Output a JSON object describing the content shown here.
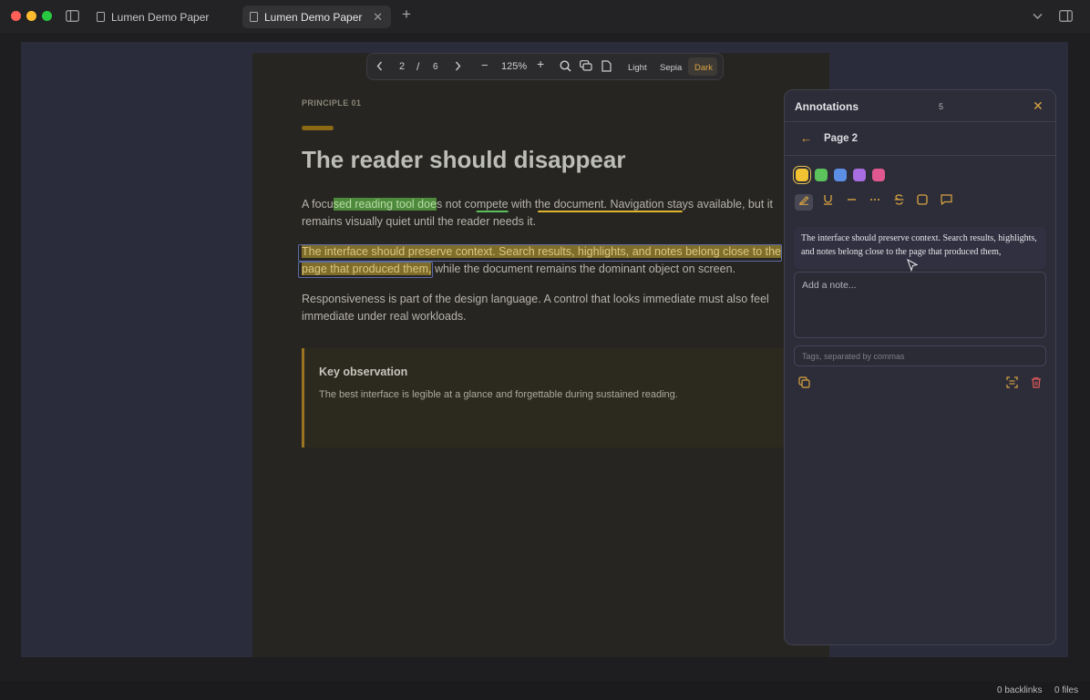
{
  "window": {
    "tabs": [
      {
        "label": "Lumen Demo Paper",
        "active": false
      },
      {
        "label": "Lumen Demo Paper",
        "active": true
      }
    ],
    "icons": [
      "sidebar-toggle-icon",
      "new-tab-icon",
      "chevron-down-icon",
      "right-panel-icon"
    ]
  },
  "toolbar": {
    "current_page": "2",
    "separator": "/",
    "total_pages": "6",
    "zoom": "125%",
    "themes": [
      "Light",
      "Sepia",
      "Dark"
    ],
    "active_theme": "Dark"
  },
  "document": {
    "eyebrow": "PRINCIPLE 01",
    "title": "The reader should disappear",
    "p1": {
      "a": "A focu",
      "hl_green": "sed reading tool doe",
      "b": "s not ",
      "c": "co",
      "ul_green": "mpete",
      "d": " with ",
      "e": "t",
      "ul_yellow": "he document. Navigation sta",
      "f": "ys available, but it remains visually quiet until the reader needs it."
    },
    "p2": {
      "hl_yellow": "The interface should preserve context. Search results, highlights, and notes belong close to the page that produced them,",
      "rest": " while the document remains the dominant object on screen."
    },
    "p3": "Responsiveness is part of the design language. A control that looks immediate must also feel immediate under real workloads.",
    "callout": {
      "title": "Key observation",
      "text": "The best interface is legible at a glance and forgettable during sustained reading."
    }
  },
  "annotations": {
    "title": "Annotations",
    "count": "5",
    "page_label": "Page 2",
    "colors": [
      "#f2c232",
      "#5cc25c",
      "#5b8fe6",
      "#a86de0",
      "#e0588f"
    ],
    "selected_color": "#f2c232",
    "tools": [
      "highlight-icon",
      "underline-icon",
      "strike-line-icon",
      "dotted-line-icon",
      "strikethrough-icon",
      "box-icon",
      "comment-icon"
    ],
    "quote": "The interface should preserve context. Search results, highlights, and notes belong close to the page that produced them,",
    "note_placeholder": "Add a note...",
    "tags_placeholder": "Tags, separated by commas"
  },
  "status": {
    "backlinks": "0 backlinks",
    "files": "0 files"
  }
}
